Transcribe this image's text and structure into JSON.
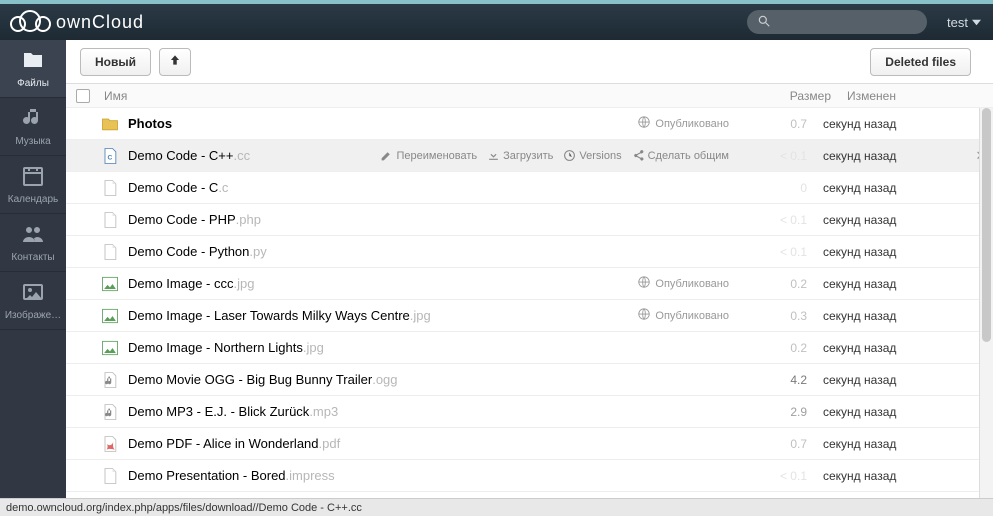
{
  "brand": "ownCloud",
  "search": {
    "placeholder": ""
  },
  "user": {
    "name": "test"
  },
  "sidebar": {
    "items": [
      {
        "label": "Файлы",
        "icon": "folder",
        "active": true
      },
      {
        "label": "Музыка",
        "icon": "music",
        "active": false
      },
      {
        "label": "Календарь",
        "icon": "calendar",
        "active": false
      },
      {
        "label": "Контакты",
        "icon": "contacts",
        "active": false
      },
      {
        "label": "Изображе…",
        "icon": "images",
        "active": false
      }
    ]
  },
  "toolbar": {
    "new_label": "Новый",
    "deleted_label": "Deleted files"
  },
  "columns": {
    "name": "Имя",
    "size": "Размер",
    "modified": "Изменен"
  },
  "hover_actions": {
    "rename": "Переименовать",
    "download": "Загрузить",
    "versions": "Versions",
    "share": "Сделать общим"
  },
  "shared_label": "Опубликовано",
  "files": [
    {
      "name": "Photos",
      "ext": "",
      "type": "folder",
      "shared": true,
      "size": "0.7",
      "size_tone": "dim",
      "modified": "секунд назад",
      "strong": true,
      "hovered": false
    },
    {
      "name": "Demo Code - C++",
      "ext": ".cc",
      "type": "code-cpp",
      "shared": false,
      "size": "< 0.1",
      "size_tone": "faint",
      "modified": "секунд назад",
      "strong": false,
      "hovered": true
    },
    {
      "name": "Demo Code - C",
      "ext": ".c",
      "type": "file",
      "shared": false,
      "size": "0",
      "size_tone": "faint",
      "modified": "секунд назад",
      "strong": false,
      "hovered": false
    },
    {
      "name": "Demo Code - PHP",
      "ext": ".php",
      "type": "file",
      "shared": false,
      "size": "< 0.1",
      "size_tone": "faint",
      "modified": "секунд назад",
      "strong": false,
      "hovered": false
    },
    {
      "name": "Demo Code - Python",
      "ext": ".py",
      "type": "file",
      "shared": false,
      "size": "< 0.1",
      "size_tone": "faint",
      "modified": "секунд назад",
      "strong": false,
      "hovered": false
    },
    {
      "name": "Demo Image - ccc",
      "ext": ".jpg",
      "type": "image",
      "shared": true,
      "size": "0.2",
      "size_tone": "dim",
      "modified": "секунд назад",
      "strong": false,
      "hovered": false
    },
    {
      "name": "Demo Image - Laser Towards Milky Ways Centre",
      "ext": ".jpg",
      "type": "image",
      "shared": true,
      "size": "0.3",
      "size_tone": "dim",
      "modified": "секунд назад",
      "strong": false,
      "hovered": false
    },
    {
      "name": "Demo Image - Northern Lights",
      "ext": ".jpg",
      "type": "image",
      "shared": false,
      "size": "0.2",
      "size_tone": "dim",
      "modified": "секунд назад",
      "strong": false,
      "hovered": false
    },
    {
      "name": "Demo Movie OGG - Big Bug Bunny Trailer",
      "ext": ".ogg",
      "type": "audio",
      "shared": false,
      "size": "4.2",
      "size_tone": "strong",
      "modified": "секунд назад",
      "strong": false,
      "hovered": false
    },
    {
      "name": "Demo MP3 - E.J. - Blick Zurück",
      "ext": ".mp3",
      "type": "audio",
      "shared": false,
      "size": "2.9",
      "size_tone": "mid",
      "modified": "секунд назад",
      "strong": false,
      "hovered": false
    },
    {
      "name": "Demo PDF - Alice in Wonderland",
      "ext": ".pdf",
      "type": "pdf",
      "shared": false,
      "size": "0.7",
      "size_tone": "dim",
      "modified": "секунд назад",
      "strong": false,
      "hovered": false
    },
    {
      "name": "Demo Presentation - Bored",
      "ext": ".impress",
      "type": "file",
      "shared": false,
      "size": "< 0.1",
      "size_tone": "faint",
      "modified": "секунд назад",
      "strong": false,
      "hovered": false
    }
  ],
  "statusbar": "demo.owncloud.org/index.php/apps/files/download//Demo Code - C++.cc"
}
